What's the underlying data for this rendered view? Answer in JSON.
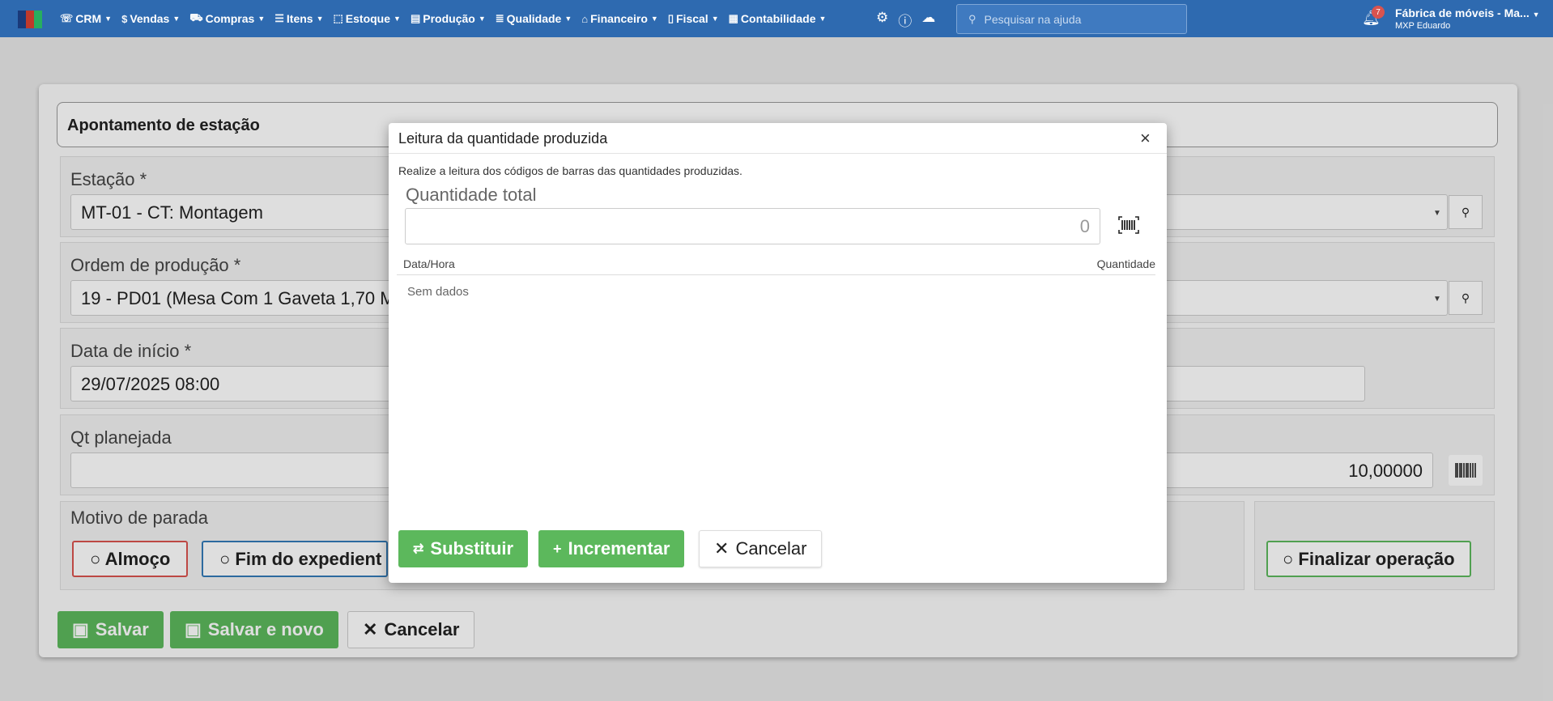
{
  "colors": {
    "topbar": "#2e6ab0",
    "success": "#5cb85c",
    "danger": "#d9534f",
    "info": "#337ab7",
    "logo": [
      "#1a3a7a",
      "#c0392b",
      "#27ae60"
    ]
  },
  "nav": [
    {
      "label": "CRM",
      "icon": "crm-icon"
    },
    {
      "label": "Vendas",
      "icon": "dollar-icon"
    },
    {
      "label": "Compras",
      "icon": "cart-icon"
    },
    {
      "label": "Itens",
      "icon": "list-icon"
    },
    {
      "label": "Estoque",
      "icon": "box-icon"
    },
    {
      "label": "Produção",
      "icon": "factory-icon"
    },
    {
      "label": "Qualidade",
      "icon": "checklist-icon"
    },
    {
      "label": "Financeiro",
      "icon": "bank-icon"
    },
    {
      "label": "Fiscal",
      "icon": "document-icon"
    },
    {
      "label": "Contabilidade",
      "icon": "calculator-icon"
    }
  ],
  "search": {
    "placeholder": "Pesquisar na ajuda"
  },
  "notifications": {
    "count": "7"
  },
  "company": {
    "name": "Fábrica de móveis - Ma...",
    "user": "MXP Eduardo"
  },
  "form": {
    "title": "Apontamento de estação",
    "station_label": "Estação *",
    "station_value": "MT-01 - CT: Montagem",
    "order_label": "Ordem de produção *",
    "order_value": "19 - PD01 (Mesa Com 1 Gaveta 1,70 M",
    "start_label": "Data de início *",
    "start_value": "29/07/2025 08:00",
    "qty_label": "Qt planejada",
    "qty_value": "10,00000",
    "reason_label": "Motivo de parada",
    "reason_lunch": "○ Almoço",
    "reason_end": "○ Fim do expedient",
    "finish_label": "○ Finalizar operação",
    "save": "Salvar",
    "save_new": "Salvar e novo",
    "cancel": "Cancelar"
  },
  "modal": {
    "title": "Leitura da quantidade produzida",
    "close": "×",
    "description": "Realize a leitura dos códigos de barras das quantidades produzidas.",
    "total_label": "Quantidade total",
    "total_value": "0",
    "col_datetime": "Data/Hora",
    "col_quantity": "Quantidade",
    "empty": "Sem dados",
    "replace": "Substituir",
    "increment": "Incrementar",
    "cancel": "Cancelar"
  }
}
